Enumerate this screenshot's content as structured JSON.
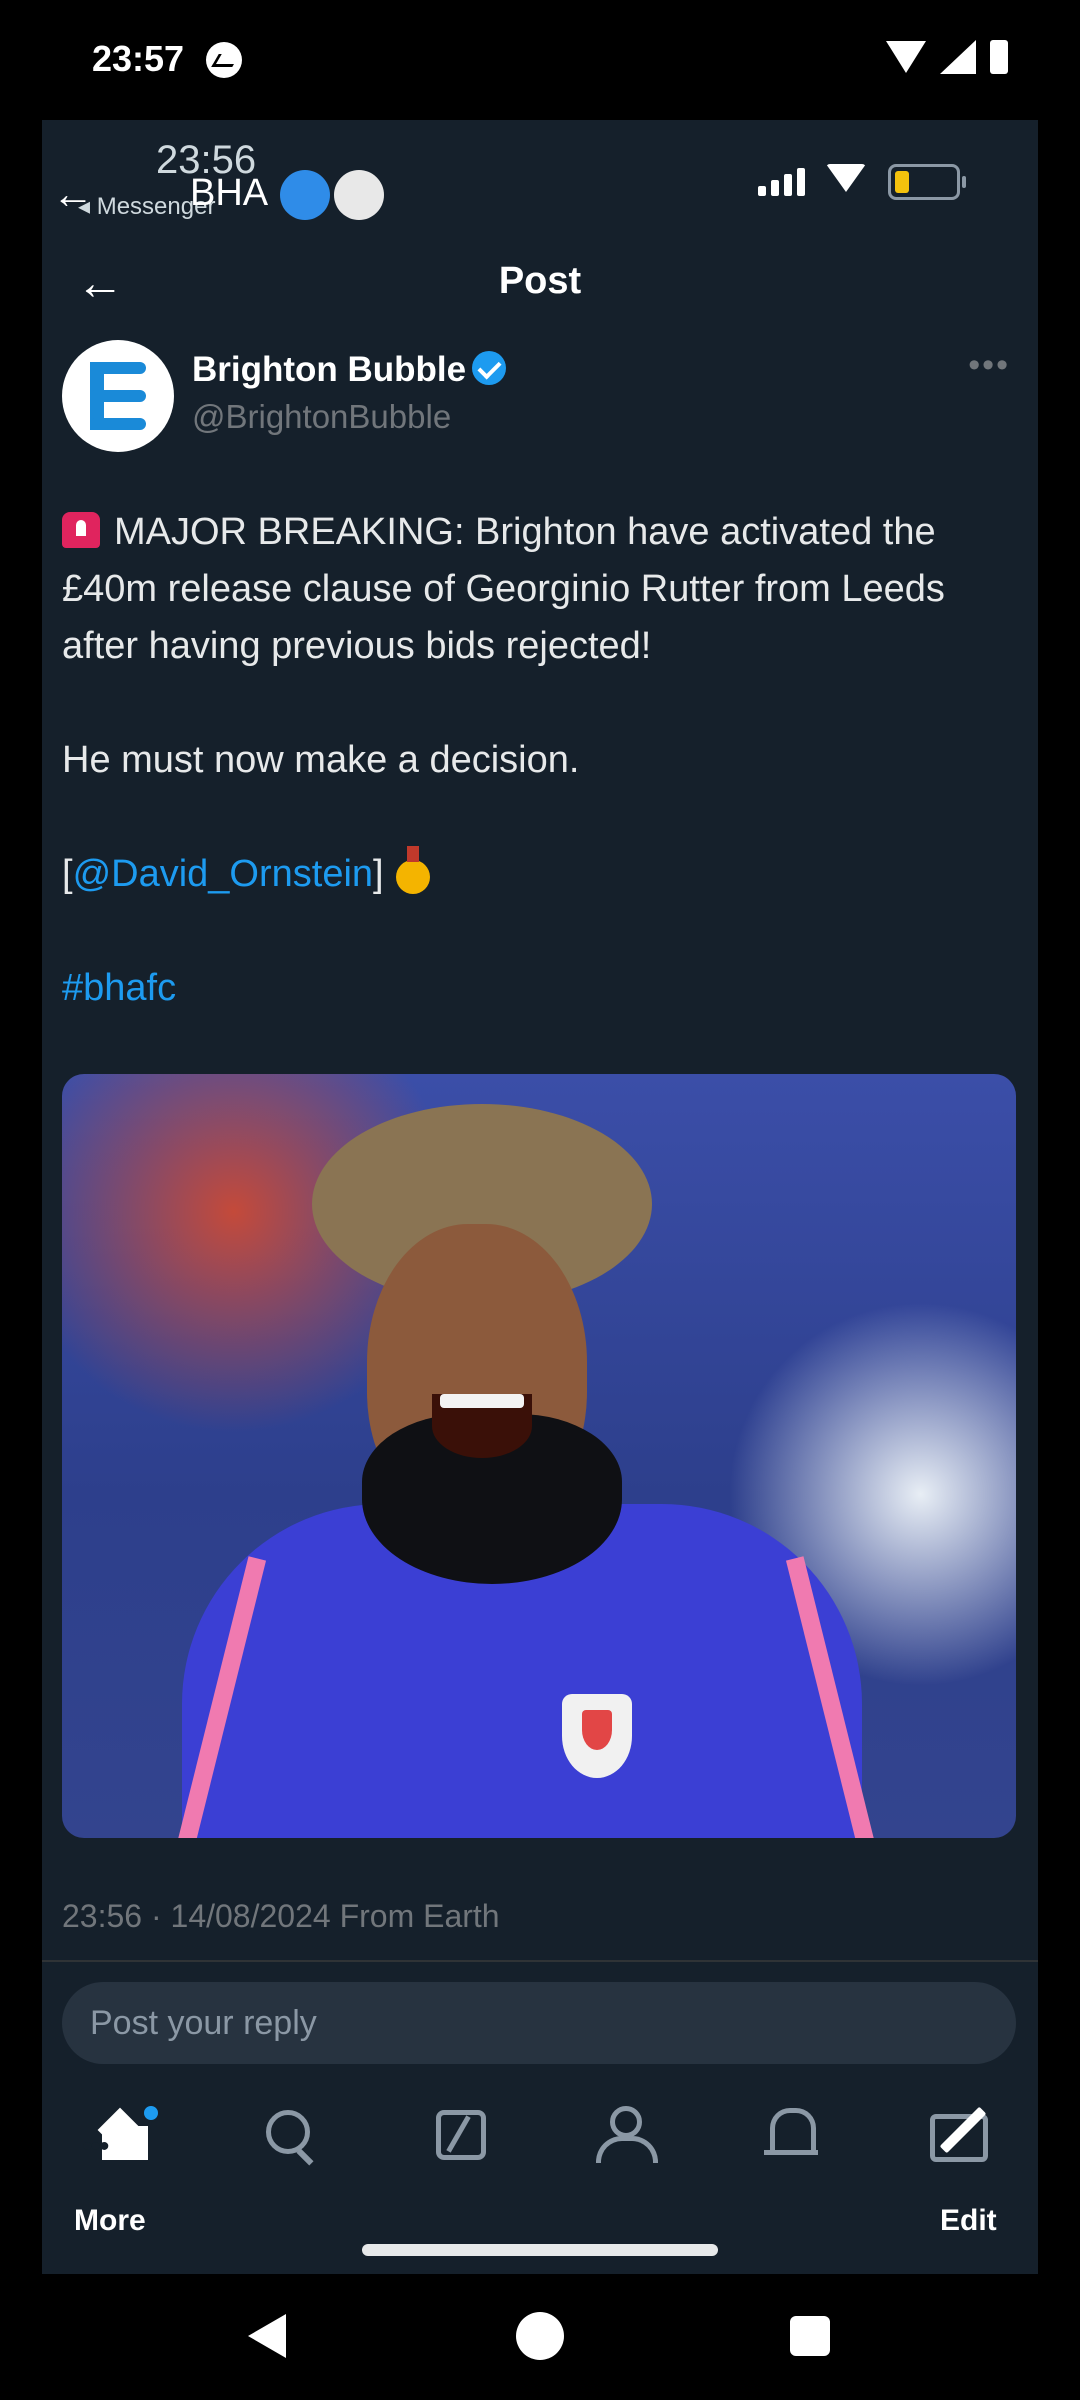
{
  "system_status": {
    "time": "23:57"
  },
  "inner_status": {
    "time": "23:56",
    "back_app": "Messenger",
    "chat_title": "BHA"
  },
  "header": {
    "title": "Post"
  },
  "post": {
    "author_name": "Brighton Bubble",
    "handle": "@BrightonBubble",
    "line1": "MAJOR BREAKING: Brighton have activated the £40m release clause of Georginio Rutter from Leeds after having previous bids rejected!",
    "line2": "He must now make a decision.",
    "source_open": "[",
    "source_mention": "@David_Ornstein",
    "source_close": "]",
    "hashtag": "#bhafc",
    "timestamp": "23:56 · 14/08/2024 From Earth"
  },
  "reply": {
    "placeholder": "Post your reply"
  },
  "tabbar": {
    "left_label": "More",
    "right_label": "Edit"
  },
  "colors": {
    "background": "#15202b",
    "accent": "#1d9bf0",
    "muted": "#71767b"
  },
  "icons": [
    "messenger-icon",
    "wifi-icon",
    "signal-icon",
    "battery-icon",
    "back-arrow-icon",
    "verified-icon",
    "more-icon",
    "siren-emoji",
    "medal-emoji",
    "home-icon",
    "search-icon",
    "grok-icon",
    "communities-icon",
    "bell-icon",
    "messages-icon"
  ]
}
